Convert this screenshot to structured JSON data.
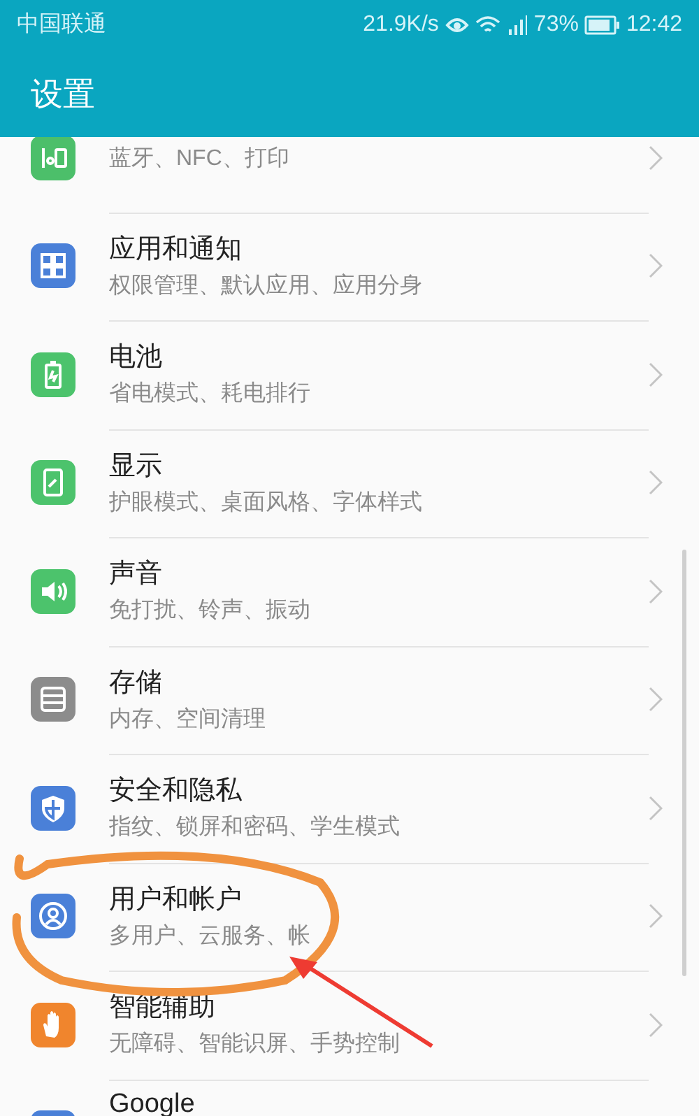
{
  "status_bar": {
    "carrier": "中国联通",
    "speed": "21.9K/s",
    "battery": "73%",
    "time": "12:42"
  },
  "title": "设置",
  "rows": [
    {
      "kind": "connect",
      "color": "#4cbf6a",
      "subtitle": "蓝牙、NFC、打印"
    },
    {
      "kind": "apps",
      "color": "#4a80d8",
      "title": "应用和通知",
      "subtitle": "权限管理、默认应用、应用分身"
    },
    {
      "kind": "battery",
      "color": "#4cc36c",
      "title": "电池",
      "subtitle": "省电模式、耗电排行"
    },
    {
      "kind": "display",
      "color": "#4cc36c",
      "title": "显示",
      "subtitle": "护眼模式、桌面风格、字体样式"
    },
    {
      "kind": "sound",
      "color": "#4cc36c",
      "title": "声音",
      "subtitle": "免打扰、铃声、振动"
    },
    {
      "kind": "storage",
      "color": "#8c8c8c",
      "title": "存储",
      "subtitle": "内存、空间清理"
    },
    {
      "kind": "security",
      "color": "#4a80d8",
      "title": "安全和隐私",
      "subtitle": "指纹、锁屏和密码、学生模式"
    },
    {
      "kind": "user",
      "color": "#4a80d8",
      "title": "用户和帐户",
      "subtitle": "多用户、云服务、帐"
    },
    {
      "kind": "assist",
      "color": "#f0852d",
      "title": "智能辅助",
      "subtitle": "无障碍、智能识屏、手势控制"
    },
    {
      "kind": "google",
      "color": "#4a80d8",
      "title": "Google"
    }
  ]
}
